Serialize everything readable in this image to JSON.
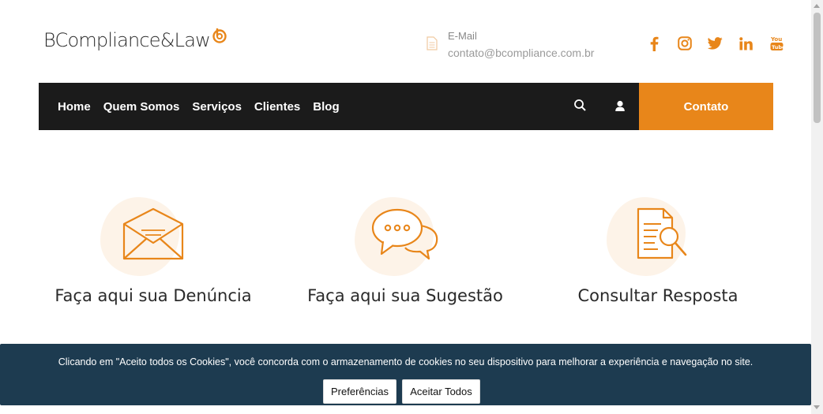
{
  "header": {
    "logo_text": "BCompliance&Law",
    "email_label": "E-Mail",
    "email_value": "contato@bcompliance.com.br",
    "socials": [
      "facebook-icon",
      "instagram-icon",
      "twitter-icon",
      "linkedin-icon",
      "youtube-icon"
    ]
  },
  "nav": {
    "links": [
      "Home",
      "Quem Somos",
      "Serviços",
      "Clientes",
      "Blog"
    ],
    "contact_label": "Contato"
  },
  "cards": [
    {
      "title": "Faça aqui sua Denúncia",
      "icon": "envelope-icon"
    },
    {
      "title": "Faça aqui sua Sugestão",
      "icon": "chat-bubbles-icon"
    },
    {
      "title": "Consultar Resposta",
      "icon": "document-search-icon"
    }
  ],
  "cookie": {
    "text": "Clicando em \"Aceito todos os Cookies\", você concorda com o armazenamento de cookies no seu dispositivo para melhorar a experiência e navegação no site.",
    "preferences_label": "Preferências",
    "accept_label": "Aceitar Todos"
  },
  "colors": {
    "accent": "#e8861a",
    "navbar": "#1b1b1b",
    "cookie_bg": "#1d3b50"
  }
}
